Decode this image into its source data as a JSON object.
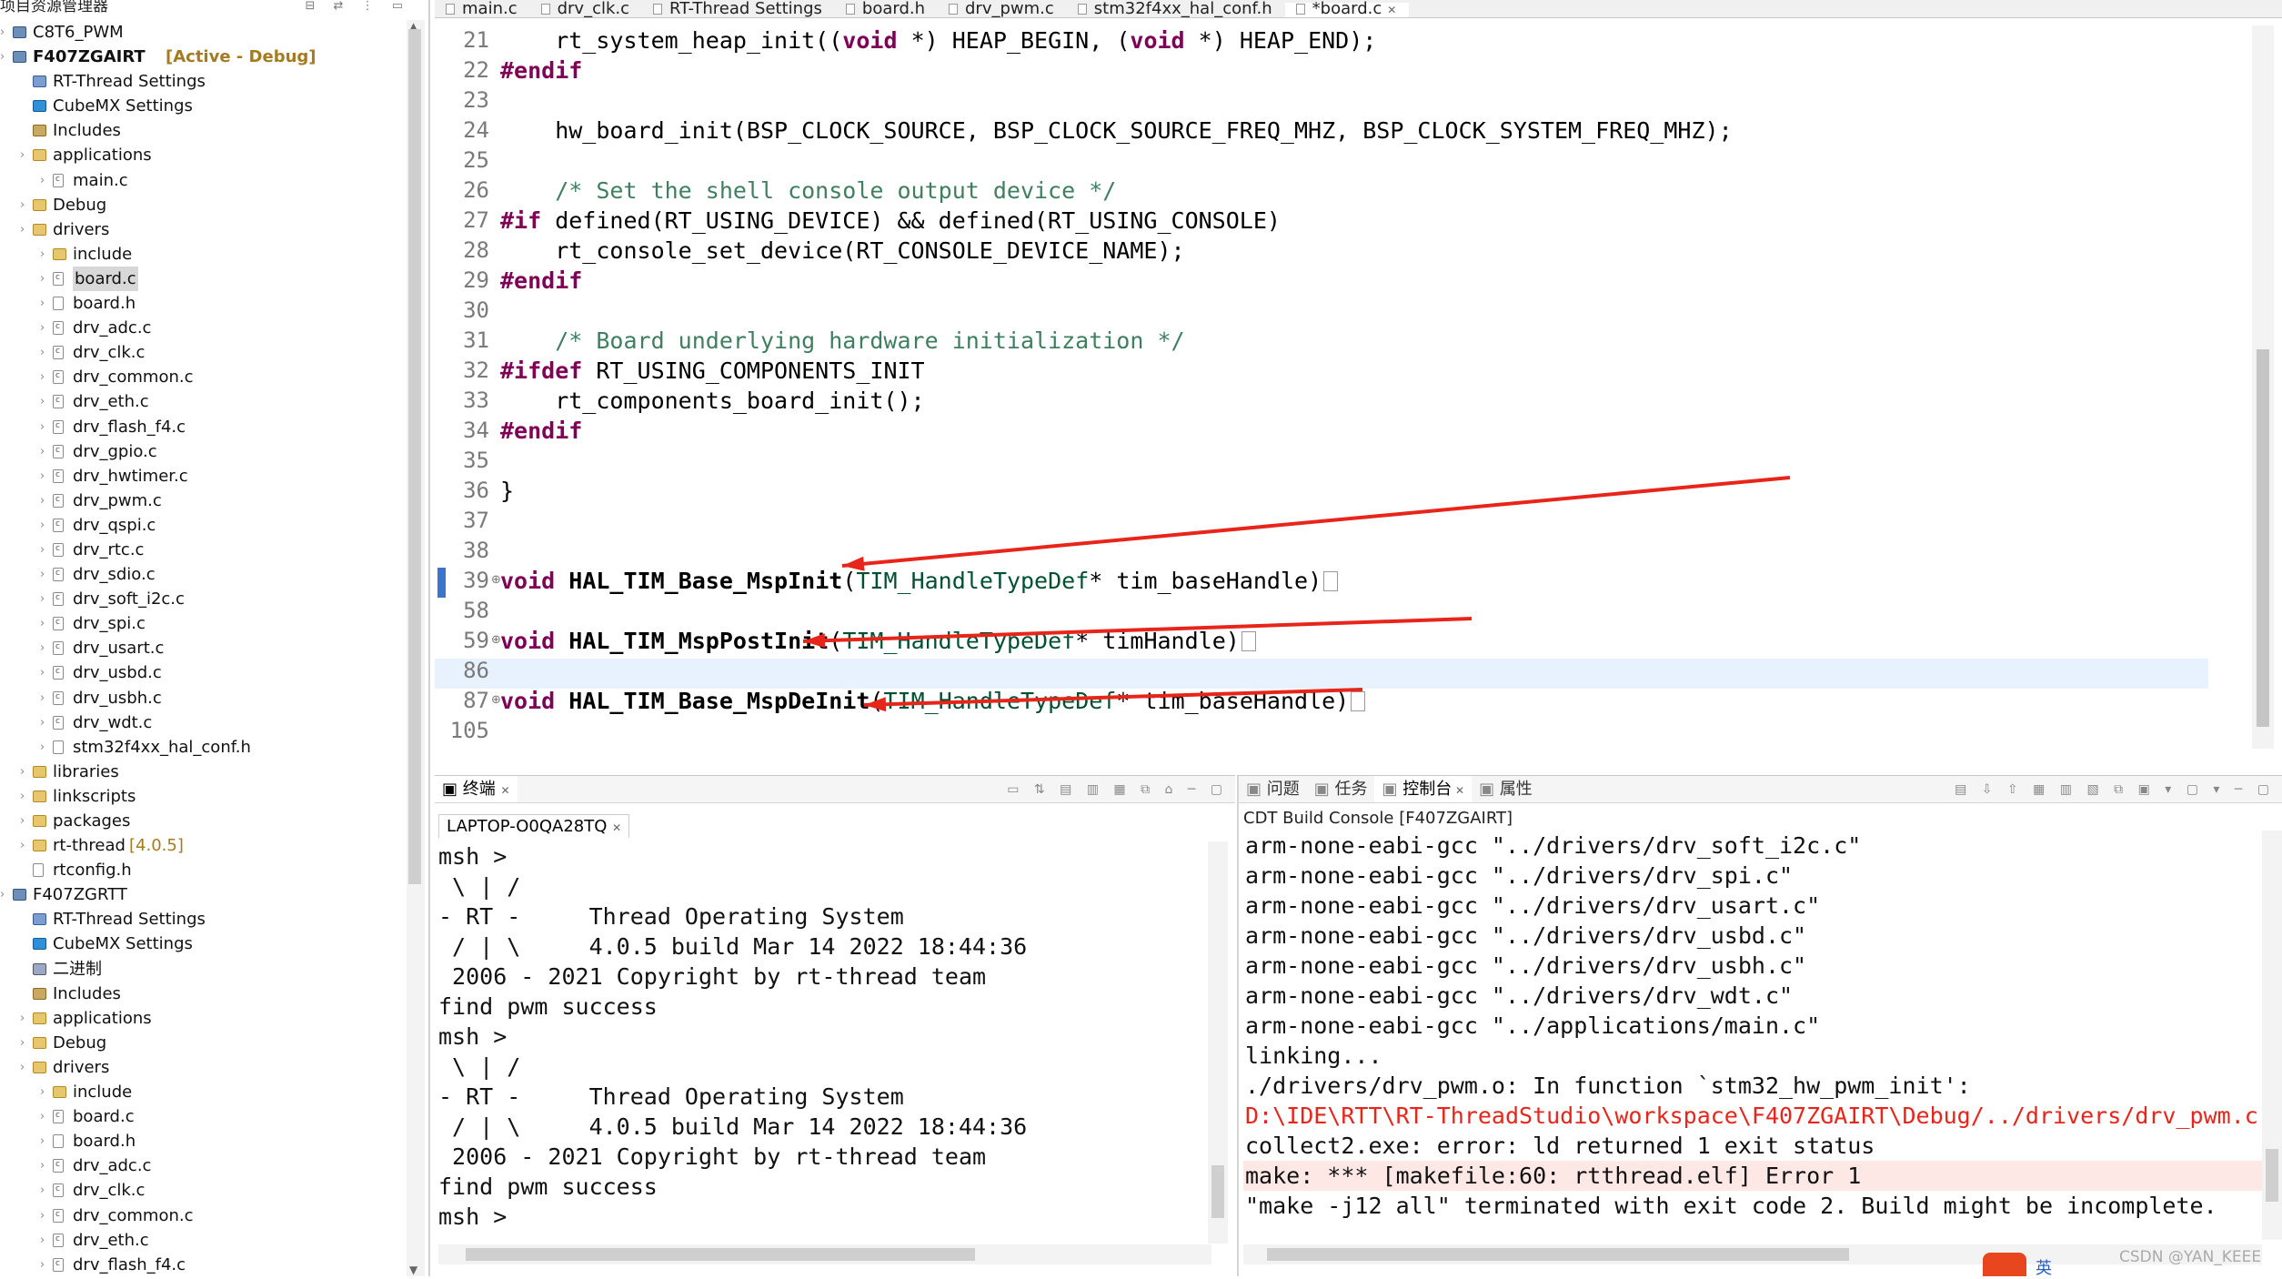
{
  "explorer": {
    "title": "项目资源管理器",
    "rows": [
      {
        "label": "C8T6_PWM",
        "icon": "project"
      },
      {
        "label": "F407ZGAIRT",
        "icon": "project",
        "suffix": "[Active - Debug]",
        "bold": true
      },
      {
        "label": "RT-Thread Settings",
        "icon": "gear"
      },
      {
        "label": "CubeMX Settings",
        "icon": "cube"
      },
      {
        "label": "Includes",
        "icon": "includes"
      },
      {
        "label": "applications",
        "icon": "folder"
      },
      {
        "label": "main.c",
        "icon": "cfile"
      },
      {
        "label": "Debug",
        "icon": "folder"
      },
      {
        "label": "drivers",
        "icon": "folder"
      },
      {
        "label": "include",
        "icon": "folder"
      },
      {
        "label": "board.c",
        "icon": "cfile",
        "selected": true
      },
      {
        "label": "board.h",
        "icon": "file"
      },
      {
        "label": "drv_adc.c",
        "icon": "cfile"
      },
      {
        "label": "drv_clk.c",
        "icon": "cfile"
      },
      {
        "label": "drv_common.c",
        "icon": "cfile"
      },
      {
        "label": "drv_eth.c",
        "icon": "cfile"
      },
      {
        "label": "drv_flash_f4.c",
        "icon": "cfile"
      },
      {
        "label": "drv_gpio.c",
        "icon": "cfile"
      },
      {
        "label": "drv_hwtimer.c",
        "icon": "cfile"
      },
      {
        "label": "drv_pwm.c",
        "icon": "cfile"
      },
      {
        "label": "drv_qspi.c",
        "icon": "cfile"
      },
      {
        "label": "drv_rtc.c",
        "icon": "cfile"
      },
      {
        "label": "drv_sdio.c",
        "icon": "cfile"
      },
      {
        "label": "drv_soft_i2c.c",
        "icon": "cfile"
      },
      {
        "label": "drv_spi.c",
        "icon": "cfile"
      },
      {
        "label": "drv_usart.c",
        "icon": "cfile"
      },
      {
        "label": "drv_usbd.c",
        "icon": "cfile"
      },
      {
        "label": "drv_usbh.c",
        "icon": "cfile"
      },
      {
        "label": "drv_wdt.c",
        "icon": "cfile"
      },
      {
        "label": "stm32f4xx_hal_conf.h",
        "icon": "file"
      },
      {
        "label": "libraries",
        "icon": "folder"
      },
      {
        "label": "linkscripts",
        "icon": "folder"
      },
      {
        "label": "packages",
        "icon": "folder"
      },
      {
        "label": "rt-thread",
        "icon": "folder",
        "suffix": "[4.0.5]"
      },
      {
        "label": "rtconfig.h",
        "icon": "file"
      },
      {
        "label": "F407ZGRTT",
        "icon": "project"
      },
      {
        "label": "RT-Thread Settings",
        "icon": "gear"
      },
      {
        "label": "CubeMX Settings",
        "icon": "cube"
      },
      {
        "label": "二进制",
        "icon": "binary"
      },
      {
        "label": "Includes",
        "icon": "includes"
      },
      {
        "label": "applications",
        "icon": "folder"
      },
      {
        "label": "Debug",
        "icon": "folder"
      },
      {
        "label": "drivers",
        "icon": "folder"
      },
      {
        "label": "include",
        "icon": "folder"
      },
      {
        "label": "board.c",
        "icon": "cfile"
      },
      {
        "label": "board.h",
        "icon": "file"
      },
      {
        "label": "drv_adc.c",
        "icon": "cfile"
      },
      {
        "label": "drv_clk.c",
        "icon": "cfile"
      },
      {
        "label": "drv_common.c",
        "icon": "cfile"
      },
      {
        "label": "drv_eth.c",
        "icon": "cfile"
      },
      {
        "label": "drv_flash_f4.c",
        "icon": "cfile"
      }
    ]
  },
  "editor": {
    "tabs": [
      {
        "label": "main.c",
        "active": false
      },
      {
        "label": "drv_clk.c",
        "active": false
      },
      {
        "label": "RT-Thread Settings",
        "active": false
      },
      {
        "label": "board.h",
        "active": false
      },
      {
        "label": "drv_pwm.c",
        "active": false
      },
      {
        "label": "stm32f4xx_hal_conf.h",
        "active": false
      },
      {
        "label": "*board.c",
        "active": true
      }
    ],
    "lines": [
      {
        "n": "21",
        "code": [
          [
            "    rt_system_heap_init((",
            ""
          ],
          [
            "void",
            "kw"
          ],
          [
            " *) HEAP_BEGIN, (",
            ""
          ],
          [
            "void",
            "kw"
          ],
          [
            " *) HEAP_END);",
            ""
          ]
        ]
      },
      {
        "n": "22",
        "code": [
          [
            "#endif",
            "pre"
          ]
        ]
      },
      {
        "n": "23",
        "code": []
      },
      {
        "n": "24",
        "code": [
          [
            "    hw_board_init(BSP_CLOCK_SOURCE, BSP_CLOCK_SOURCE_FREQ_MHZ, BSP_CLOCK_SYSTEM_FREQ_MHZ);",
            ""
          ]
        ]
      },
      {
        "n": "25",
        "code": []
      },
      {
        "n": "26",
        "code": [
          [
            "    /* Set the shell console output device */",
            "cm"
          ]
        ]
      },
      {
        "n": "27",
        "code": [
          [
            "#if",
            "pre"
          ],
          [
            " defined(RT_USING_DEVICE) && defined(RT_USING_CONSOLE)",
            ""
          ]
        ]
      },
      {
        "n": "28",
        "code": [
          [
            "    rt_console_set_device(RT_CONSOLE_DEVICE_NAME);",
            ""
          ]
        ]
      },
      {
        "n": "29",
        "code": [
          [
            "#endif",
            "pre"
          ]
        ]
      },
      {
        "n": "30",
        "code": []
      },
      {
        "n": "31",
        "code": [
          [
            "    /* Board underlying hardware initialization */",
            "cm"
          ]
        ]
      },
      {
        "n": "32",
        "code": [
          [
            "#ifdef",
            "pre"
          ],
          [
            " RT_USING_COMPONENTS_INIT",
            ""
          ]
        ]
      },
      {
        "n": "33",
        "code": [
          [
            "    rt_components_board_init();",
            ""
          ]
        ]
      },
      {
        "n": "34",
        "code": [
          [
            "#endif",
            "pre"
          ]
        ]
      },
      {
        "n": "35",
        "code": []
      },
      {
        "n": "36",
        "code": [
          [
            "}",
            ""
          ]
        ]
      },
      {
        "n": "37",
        "code": []
      },
      {
        "n": "38",
        "code": []
      },
      {
        "n": "39",
        "fold": true,
        "code": [
          [
            "void",
            "kw"
          ],
          [
            " ",
            ""
          ],
          [
            "HAL_TIM_Base_MspInit",
            "fn"
          ],
          [
            "(",
            ""
          ],
          [
            "TIM_HandleTypeDef",
            "ty"
          ],
          [
            "* tim_baseHandle)",
            ""
          ]
        ],
        "collapsed": true
      },
      {
        "n": "58",
        "code": []
      },
      {
        "n": "59",
        "fold": true,
        "code": [
          [
            "void",
            "kw"
          ],
          [
            " ",
            ""
          ],
          [
            "HAL_TIM_MspPostInit",
            "fn"
          ],
          [
            "(",
            ""
          ],
          [
            "TIM_HandleTypeDef",
            "ty"
          ],
          [
            "* timHandle)",
            ""
          ]
        ],
        "collapsed": true
      },
      {
        "n": "86",
        "code": []
      },
      {
        "n": "87",
        "fold": true,
        "code": [
          [
            "void",
            "kw"
          ],
          [
            " ",
            ""
          ],
          [
            "HAL_TIM_Base_MspDeInit",
            "fn"
          ],
          [
            "(",
            ""
          ],
          [
            "TIM_HandleTypeDef",
            "ty"
          ],
          [
            "* tim_baseHandle)",
            ""
          ]
        ],
        "collapsed": true
      },
      {
        "n": "105",
        "code": []
      }
    ]
  },
  "terminal": {
    "tab_label": "终端",
    "session_label": "LAPTOP-O0QA28TQ",
    "lines": [
      "msh >",
      " \\ | /",
      "- RT -     Thread Operating System",
      " / | \\     4.0.5 build Mar 14 2022 18:44:36",
      " 2006 - 2021 Copyright by rt-thread team",
      "find pwm success",
      "msh >",
      " \\ | /",
      "- RT -     Thread Operating System",
      " / | \\     4.0.5 build Mar 14 2022 18:44:36",
      " 2006 - 2021 Copyright by rt-thread team",
      "find pwm success",
      "msh >"
    ]
  },
  "console": {
    "tabs": [
      {
        "label": "问题",
        "active": false
      },
      {
        "label": "任务",
        "active": false
      },
      {
        "label": "控制台",
        "active": true
      },
      {
        "label": "属性",
        "active": false
      }
    ],
    "title": "CDT Build Console [F407ZGAIRT]",
    "lines": [
      {
        "text": "arm-none-eabi-gcc \"../drivers/drv_soft_i2c.c\"",
        "kind": "normal"
      },
      {
        "text": "arm-none-eabi-gcc \"../drivers/drv_spi.c\"",
        "kind": "normal"
      },
      {
        "text": "arm-none-eabi-gcc \"../drivers/drv_usart.c\"",
        "kind": "normal"
      },
      {
        "text": "arm-none-eabi-gcc \"../drivers/drv_usbd.c\"",
        "kind": "normal"
      },
      {
        "text": "arm-none-eabi-gcc \"../drivers/drv_usbh.c\"",
        "kind": "normal"
      },
      {
        "text": "arm-none-eabi-gcc \"../drivers/drv_wdt.c\"",
        "kind": "normal"
      },
      {
        "text": "arm-none-eabi-gcc \"../applications/main.c\"",
        "kind": "normal"
      },
      {
        "text": "linking...",
        "kind": "normal"
      },
      {
        "text": "./drivers/drv_pwm.o: In function `stm32_hw_pwm_init':",
        "kind": "normal"
      },
      {
        "text": "D:\\IDE\\RTT\\RT-ThreadStudio\\workspace\\F407ZGAIRT\\Debug/../drivers/drv_pwm.c:",
        "kind": "error"
      },
      {
        "text": "collect2.exe: error: ld returned 1 exit status",
        "kind": "normal"
      },
      {
        "text": "make: *** [makefile:60: rtthread.elf] Error 1",
        "kind": "errorbg"
      },
      {
        "text": "\"make -j12 all\" terminated with exit code 2. Build might be incomplete.",
        "kind": "normal"
      }
    ]
  },
  "watermark": "CSDN @YAN_KEEE",
  "ime_label": "英",
  "colors": {
    "annotation_arrow": "#e8251b",
    "error_text": "#e8251b",
    "keyword": "#7f0055",
    "comment": "#3f7f5f",
    "type": "#005032"
  }
}
